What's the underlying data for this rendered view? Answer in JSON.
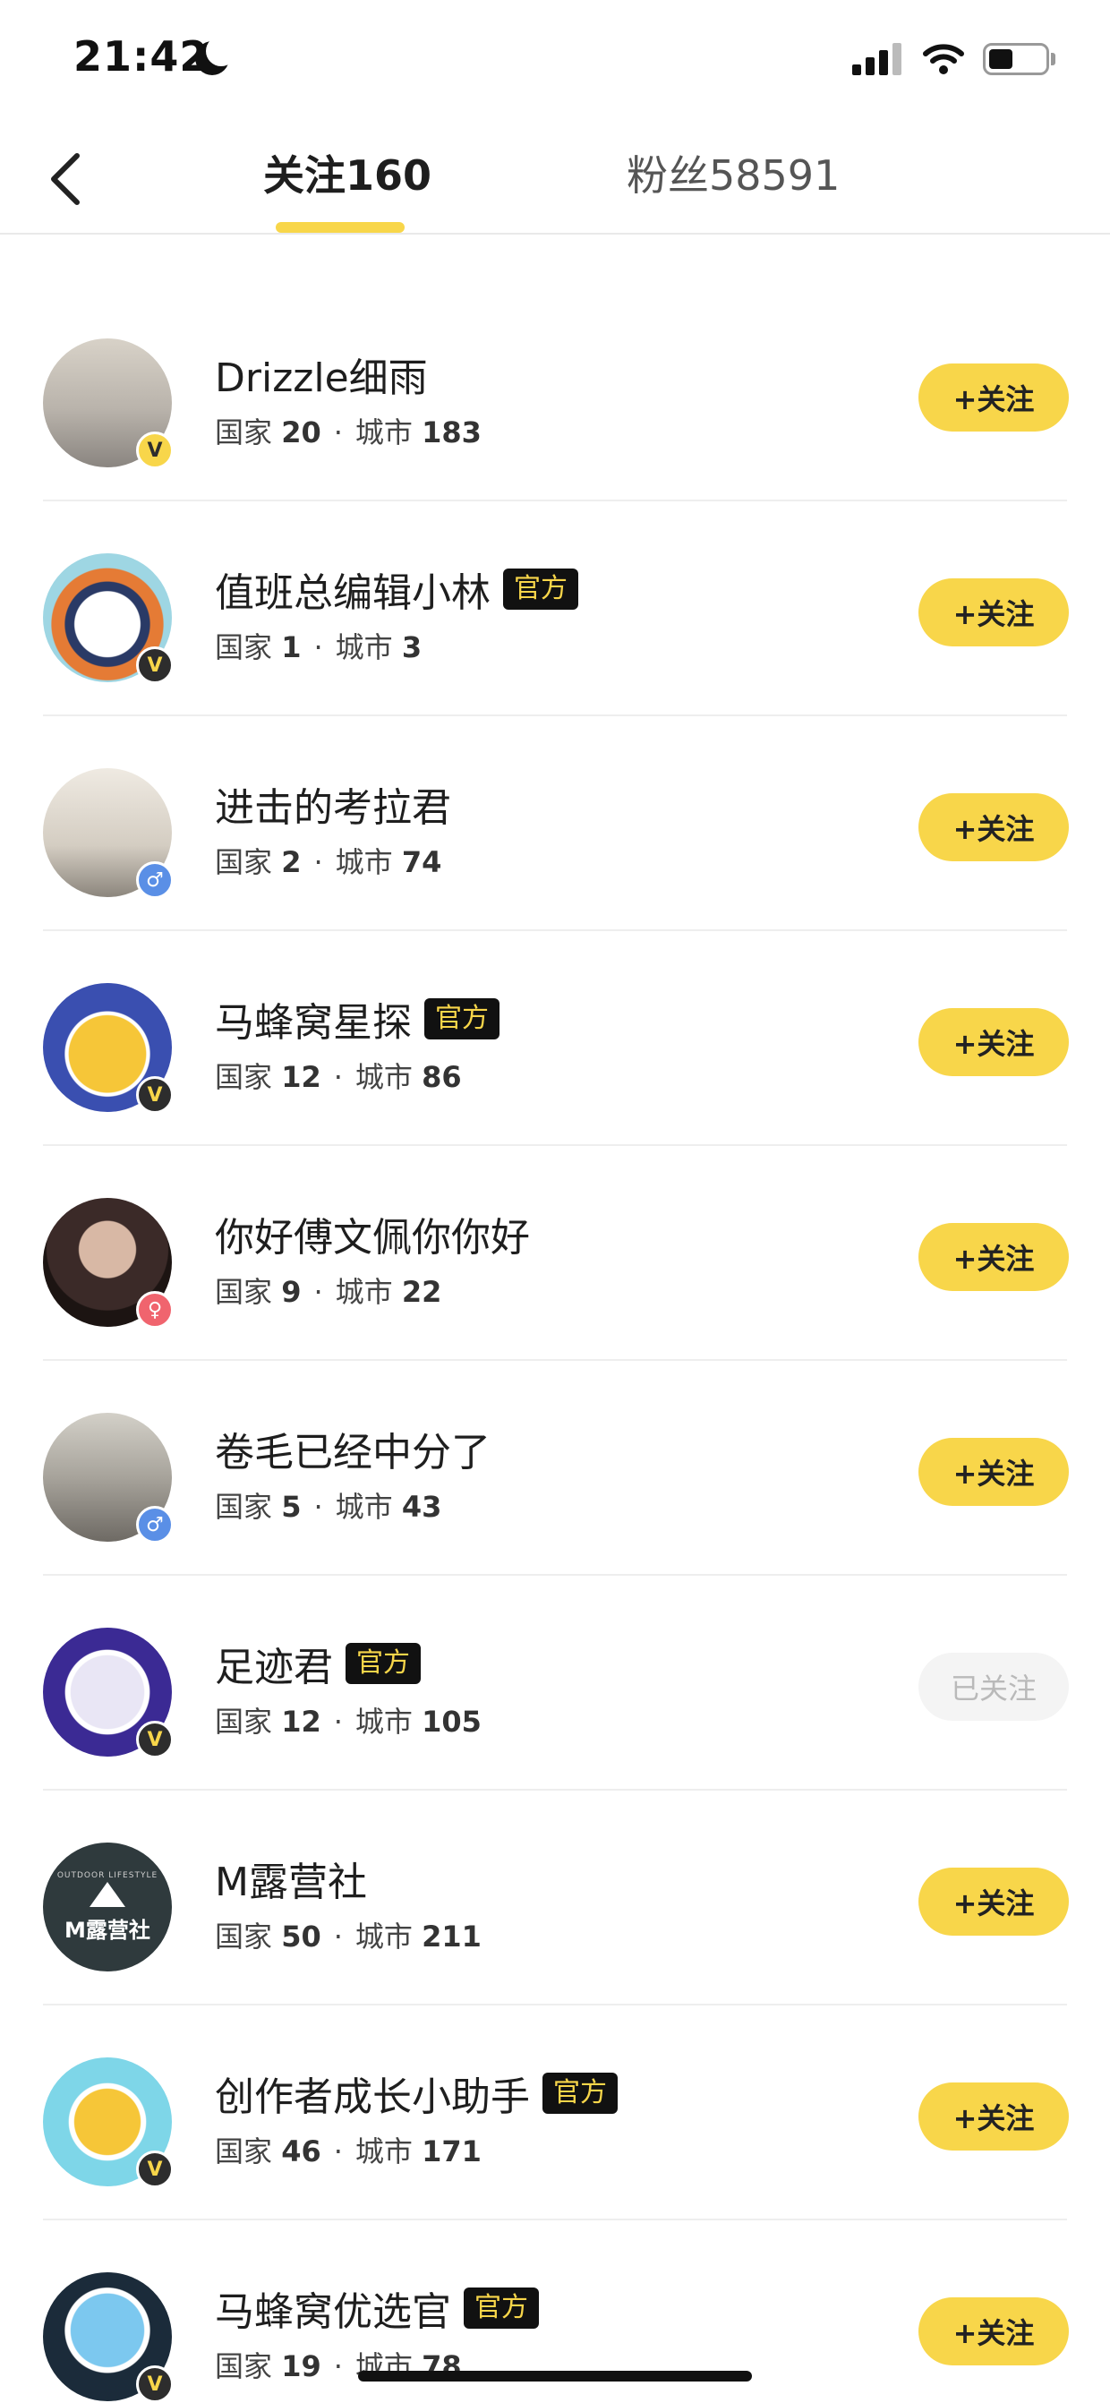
{
  "status_bar": {
    "time": "21:42"
  },
  "tabs": {
    "following": "关注160",
    "fans": "粉丝58591"
  },
  "labels": {
    "country": "国家",
    "city": "城市",
    "separator": "·"
  },
  "users": [
    {
      "name": "Drizzle细雨",
      "official": "",
      "countries": "20",
      "cities": "183",
      "button": "+关注",
      "badge": "V",
      "followed": false
    },
    {
      "name": "值班总编辑小林",
      "official": "官方",
      "countries": "1",
      "cities": "3",
      "button": "+关注",
      "badge": "V",
      "followed": false
    },
    {
      "name": "进击的考拉君",
      "official": "",
      "countries": "2",
      "cities": "74",
      "button": "+关注",
      "badge": "♂",
      "followed": false
    },
    {
      "name": "马蜂窝星探",
      "official": "官方",
      "countries": "12",
      "cities": "86",
      "button": "+关注",
      "badge": "V",
      "followed": false
    },
    {
      "name": "你好傅文佩你你好",
      "official": "",
      "countries": "9",
      "cities": "22",
      "button": "+关注",
      "badge": "♀",
      "followed": false
    },
    {
      "name": "卷毛已经中分了",
      "official": "",
      "countries": "5",
      "cities": "43",
      "button": "+关注",
      "badge": "♂",
      "followed": false
    },
    {
      "name": "足迹君",
      "official": "官方",
      "countries": "12",
      "cities": "105",
      "button": "已关注",
      "badge": "V",
      "followed": true
    },
    {
      "name": "M露营社",
      "official": "",
      "countries": "50",
      "cities": "211",
      "button": "+关注",
      "badge": "",
      "followed": false,
      "avatar_text": "M露营社",
      "avatar_subtext": "OUTDOOR LIFESTYLE"
    },
    {
      "name": "创作者成长小助手",
      "official": "官方",
      "countries": "46",
      "cities": "171",
      "button": "+关注",
      "badge": "V",
      "followed": false
    },
    {
      "name": "马蜂窝优选官",
      "official": "官方",
      "countries": "19",
      "cities": "78",
      "button": "+关注",
      "badge": "V",
      "followed": false
    }
  ]
}
